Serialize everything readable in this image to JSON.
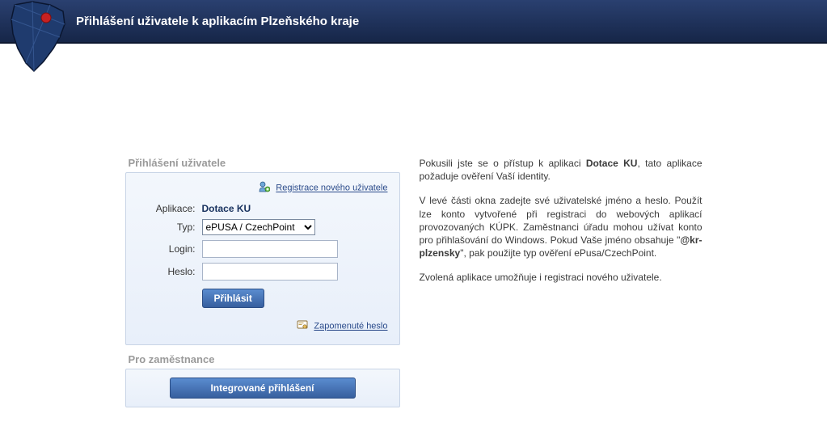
{
  "header": {
    "title": "Přihlášení uživatele k aplikacím Plzeňského kraje"
  },
  "login": {
    "section_label": "Přihlášení uživatele",
    "register_link": "Registrace nového uživatele",
    "app_label": "Aplikace:",
    "app_value": "Dotace KU",
    "type_label": "Typ:",
    "type_value": "ePUSA / CzechPoint",
    "login_label": "Login:",
    "login_value": "",
    "password_label": "Heslo:",
    "password_value": "",
    "submit_label": "Přihlásit",
    "forgot_link": "Zapomenuté heslo"
  },
  "employee": {
    "section_label": "Pro zaměstnance",
    "integrated_label": "Integrované přihlášení"
  },
  "info": {
    "p1_a": "Pokusili jste se o přístup k aplikaci ",
    "p1_b": "Dotace KU",
    "p1_c": ", tato aplikace požaduje ověření Vaší identity.",
    "p2_a": "V levé části okna zadejte své uživatelské jméno a heslo. Použít lze konto vytvořené při registraci do webových aplikací provozovaných KÚPK. Zaměstnanci úřadu mohou užívat konto pro přihlašování do Windows. Pokud Vaše jméno obsahuje \"",
    "p2_b": "@kr-plzensky",
    "p2_c": "\", pak použijte typ ověření ePusa/CzechPoint.",
    "p3": "Zvolená aplikace umožňuje i registraci nového uživatele."
  }
}
